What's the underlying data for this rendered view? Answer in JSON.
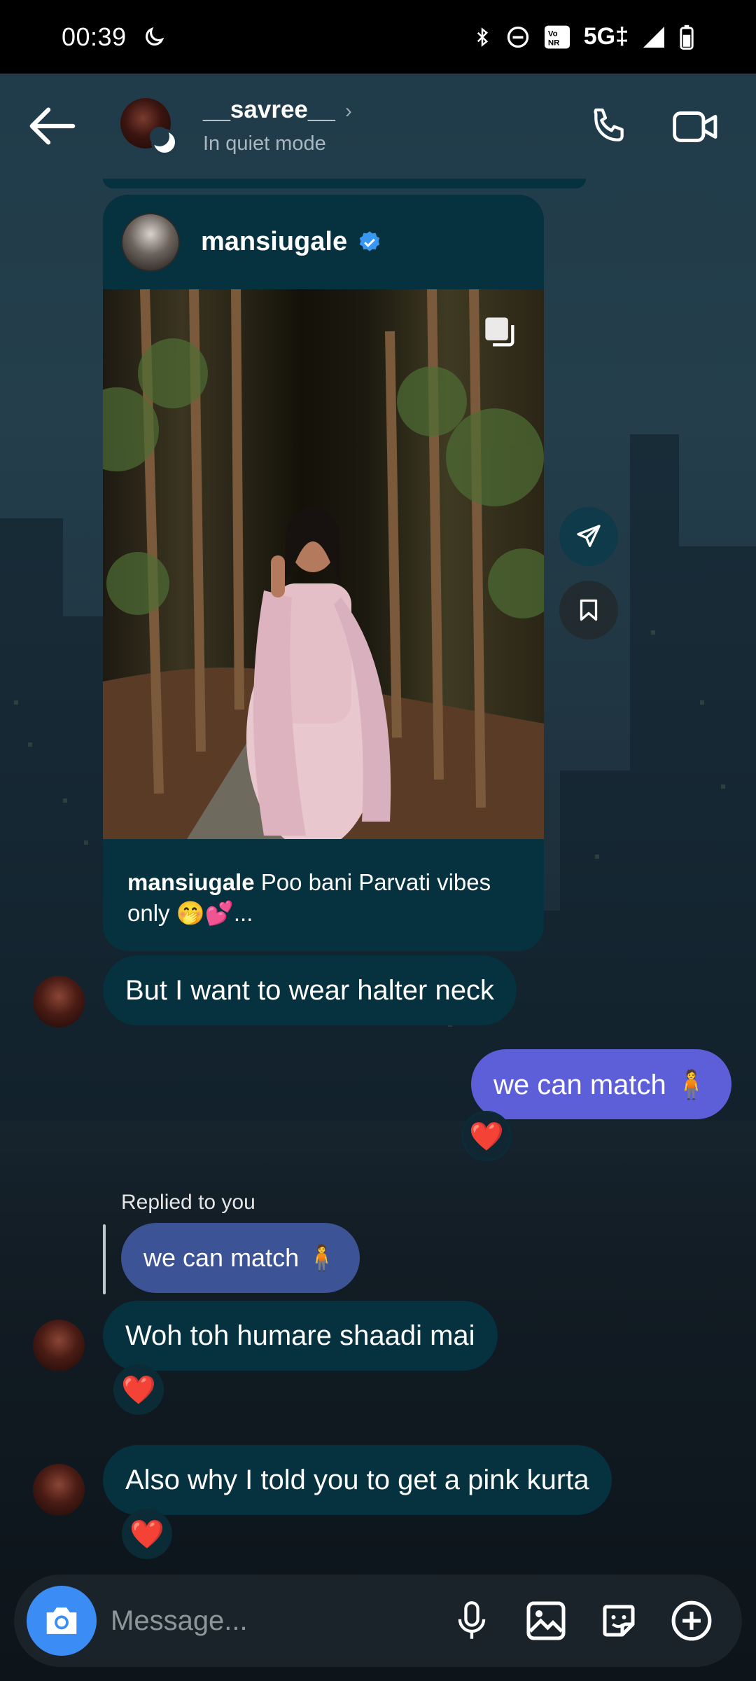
{
  "status_bar": {
    "time": "00:39",
    "network": "5G‡"
  },
  "header": {
    "name": "__savree__",
    "status": "In quiet mode"
  },
  "shared_post": {
    "username": "mansiugale",
    "caption_user": "mansiugale",
    "caption_text": " Poo bani Parvati vibes only 🤭💕..."
  },
  "messages": [
    {
      "text": "But I want to wear halter neck"
    },
    {
      "text": "we can match 🧍"
    },
    {
      "text": "Woh toh humare shaadi mai"
    },
    {
      "text": "Also why I told you to get a pink kurta"
    }
  ],
  "reply": {
    "label": "Replied to you",
    "quoted": "we can match 🧍"
  },
  "reactions": {
    "heart": "❤️"
  },
  "composer": {
    "placeholder": "Message..."
  },
  "colors": {
    "incoming_bubble": "#06313f",
    "outgoing_bubble": "#5d5fd8",
    "reply_bubble": "#3c5395",
    "camera_button": "#3b8cf5"
  }
}
